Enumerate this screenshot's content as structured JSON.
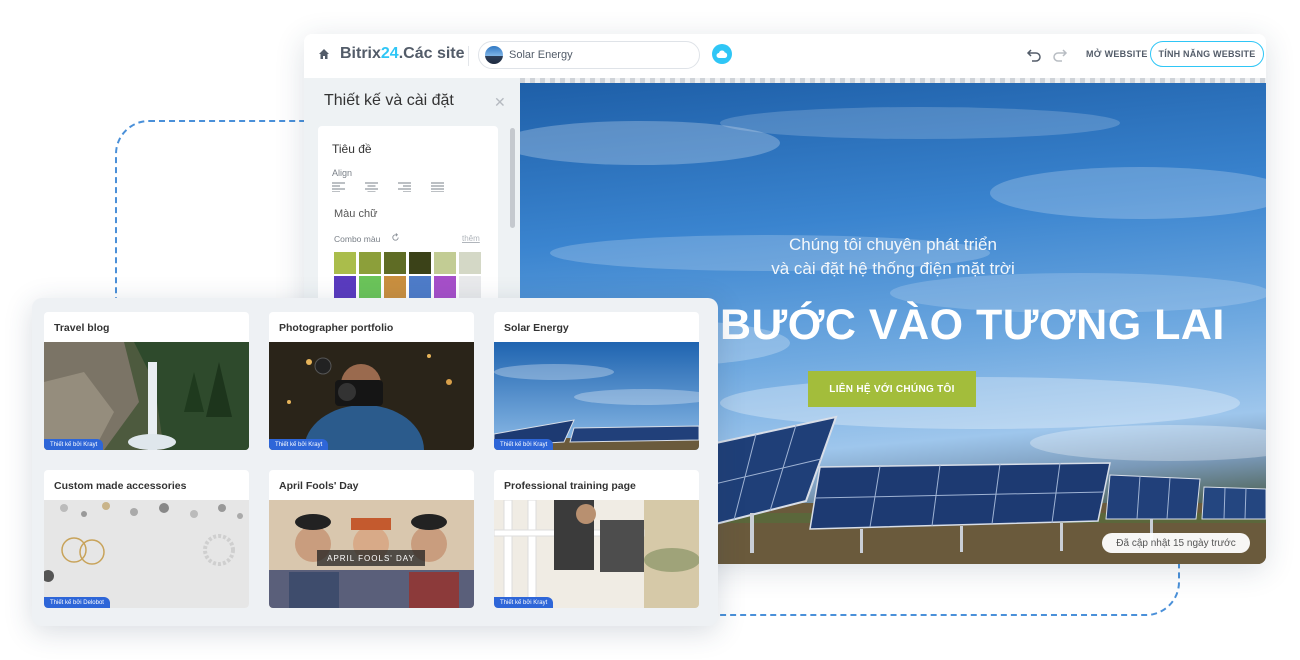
{
  "app": {
    "brand_prefix": "Bitrix",
    "brand_number": "24",
    "brand_suffix": ".Các site",
    "current_site": "Solar Energy",
    "open_website": "MỞ WEBSITE",
    "site_features": "TÍNH NĂNG WEBSITE",
    "accent_color": "#2fc6f6"
  },
  "design_panel": {
    "title": "Thiết kế và cài đặt",
    "field_title": "Tiêu đề",
    "align_label": "Align",
    "align_options": [
      "align-left-icon",
      "align-center-icon",
      "align-right-icon",
      "align-justify-icon"
    ],
    "text_color_label": "Màu chữ",
    "combo_label": "Combo màu",
    "more_link": "thêm",
    "swatches": [
      "#aabd4b",
      "#8c9f3a",
      "#5f6c25",
      "#3b4218",
      "#c2cc94",
      "#d4d8c6",
      "#5a3bbf",
      "#6bc45a",
      "#c98f3f",
      "#4e7cc9",
      "#a64fc9",
      "#e9eaec"
    ]
  },
  "hero": {
    "subtitle_line1": "Chúng tôi chuyên phát triển",
    "subtitle_line2": "và cài đặt hệ thống điện mặt trời",
    "title": "BƯỚC VÀO TƯƠNG LAI",
    "cta": "LIÊN HỆ VỚI CHÚNG TÔI",
    "updated": "Đã cập nhật 15 ngày trước",
    "cta_color": "#a3bd3b"
  },
  "templates": [
    {
      "title": "Travel blog",
      "badge": "Thiết kế bởi Krayt"
    },
    {
      "title": "Photographer portfolio",
      "badge": "Thiết kế bởi Krayt"
    },
    {
      "title": "Solar Energy",
      "badge": "Thiết kế bởi Krayt"
    },
    {
      "title": "Custom made accessories",
      "badge": "Thiết kế bởi Delobot"
    },
    {
      "title": "April Fools' Day",
      "badge": "",
      "image_text": "APRIL FOOLS' DAY"
    },
    {
      "title": "Professional training page",
      "badge": "Thiết kế bởi Krayt"
    }
  ]
}
